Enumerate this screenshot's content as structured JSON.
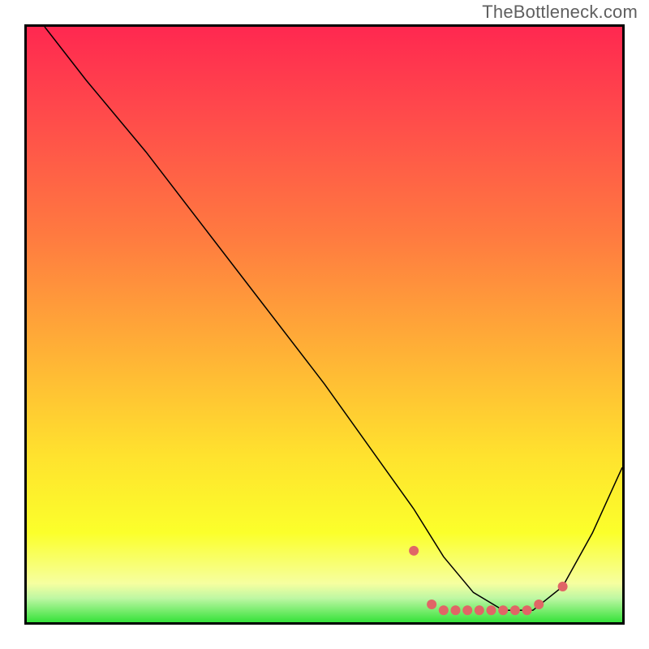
{
  "watermark": "TheBottleneck.com",
  "chart_data": {
    "type": "line",
    "title": "",
    "xlabel": "",
    "ylabel": "",
    "xlim": [
      0,
      100
    ],
    "ylim": [
      0,
      100
    ],
    "grid": false,
    "legend": false,
    "series": [
      {
        "name": "bottleneck-curve",
        "stroke": "#000000",
        "stroke_width": 1.5,
        "x": [
          3,
          10,
          20,
          30,
          40,
          50,
          60,
          65,
          70,
          75,
          80,
          85,
          90,
          95,
          100
        ],
        "values": [
          100,
          91,
          79,
          66,
          53,
          40,
          26,
          19,
          11,
          5,
          2,
          2,
          6,
          15,
          26
        ]
      },
      {
        "name": "green-band",
        "kind": "band",
        "y0": 0,
        "y1": 4,
        "fill_top": "#bdf7a3",
        "fill_bottom": "#36e23a"
      },
      {
        "name": "optimal-markers",
        "kind": "markers",
        "color": "#e06666",
        "radius": 6,
        "x": [
          65,
          68,
          70,
          72,
          74,
          76,
          78,
          80,
          82,
          84,
          86,
          90
        ],
        "values": [
          12,
          3,
          2,
          2,
          2,
          2,
          2,
          2,
          2,
          2,
          3,
          6
        ]
      }
    ],
    "background_gradient": {
      "stops": [
        {
          "offset": 0.0,
          "color": "#ff2850"
        },
        {
          "offset": 0.15,
          "color": "#ff4b4b"
        },
        {
          "offset": 0.35,
          "color": "#ff7a40"
        },
        {
          "offset": 0.55,
          "color": "#ffb236"
        },
        {
          "offset": 0.72,
          "color": "#ffe22e"
        },
        {
          "offset": 0.85,
          "color": "#fbff2b"
        },
        {
          "offset": 0.935,
          "color": "#f6ffa0"
        },
        {
          "offset": 0.96,
          "color": "#bdf7a3"
        },
        {
          "offset": 1.0,
          "color": "#36e23a"
        }
      ]
    }
  }
}
